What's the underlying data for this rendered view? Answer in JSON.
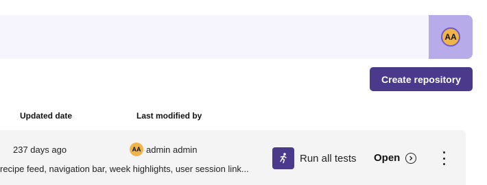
{
  "header": {
    "user_initials": "AA"
  },
  "actions": {
    "create_repository_label": "Create repository"
  },
  "table": {
    "columns": [
      "Updated date",
      "Last modified by"
    ],
    "rows": [
      {
        "updated": "237 days ago",
        "modified_by_initials": "AA",
        "modified_by": "admin admin",
        "description": "recipe feed, navigation bar, week highlights, user session link...",
        "run_label": "Run all tests",
        "open_label": "Open"
      }
    ]
  },
  "colors": {
    "accent": "#4b3a8c",
    "avatar_panel": "#b7abea",
    "avatar_fill": "#f0b44c",
    "top_bar": "#f6f4fc"
  },
  "icons": [
    "runner-icon",
    "chevron-right-circle-icon",
    "kebab-menu-icon"
  ]
}
